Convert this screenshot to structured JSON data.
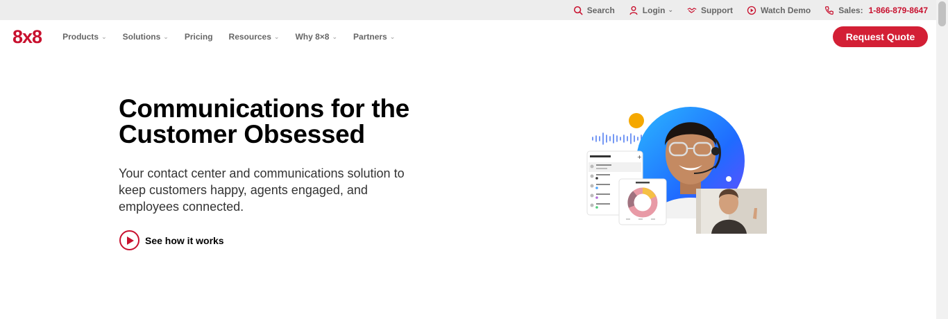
{
  "utility": {
    "search": "Search",
    "login": "Login",
    "support": "Support",
    "watch_demo": "Watch Demo",
    "sales_label": "Sales:",
    "sales_phone": "1-866-879-8647"
  },
  "nav": {
    "logo": "8x8",
    "items": [
      "Products",
      "Solutions",
      "Pricing",
      "Resources",
      "Why 8×8",
      "Partners"
    ],
    "request_quote": "Request Quote"
  },
  "hero": {
    "title": "Communications for the Customer Obsessed",
    "subtitle": "Your contact center and communications solution to keep customers happy, agents engaged, and employees connected.",
    "cta": "See how it works"
  },
  "colors": {
    "brand_red": "#c8102e",
    "button_red": "#d31f35",
    "utility_bg": "#ededed"
  },
  "icons": {
    "search": "search-icon",
    "login": "user-icon",
    "support": "handshake-icon",
    "watch_demo": "play-circle-icon",
    "sales": "phone-icon"
  }
}
